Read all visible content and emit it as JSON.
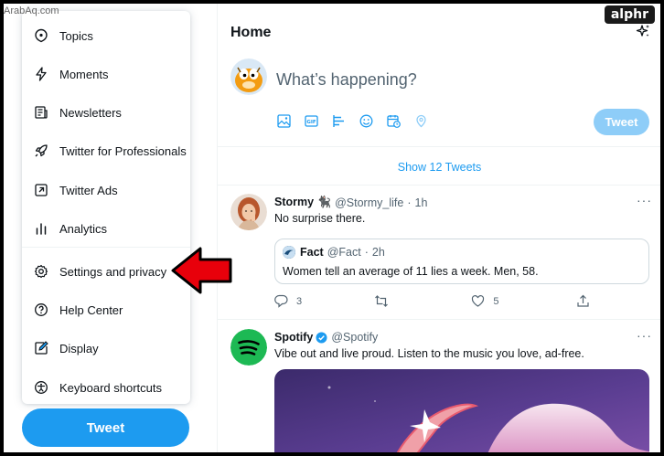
{
  "watermark": "ArabAq.com",
  "brand": "alphr",
  "menu": {
    "items": [
      {
        "label": "Topics",
        "icon": "topics-icon"
      },
      {
        "label": "Moments",
        "icon": "lightning-icon"
      },
      {
        "label": "Newsletters",
        "icon": "newsletter-icon"
      },
      {
        "label": "Twitter for Professionals",
        "icon": "rocket-icon"
      },
      {
        "label": "Twitter Ads",
        "icon": "external-arrow-icon"
      },
      {
        "label": "Analytics",
        "icon": "bar-chart-icon"
      },
      {
        "label": "Settings and privacy",
        "icon": "gear-icon"
      },
      {
        "label": "Help Center",
        "icon": "question-icon"
      },
      {
        "label": "Display",
        "icon": "pencil-icon"
      },
      {
        "label": "Keyboard shortcuts",
        "icon": "accessibility-icon"
      }
    ]
  },
  "sidebar": {
    "tweet_label": "Tweet"
  },
  "timeline": {
    "title": "Home",
    "compose": {
      "placeholder": "What’s happening?",
      "tweet_label": "Tweet"
    },
    "show_tweets": "Show 12 Tweets",
    "tweets": [
      {
        "name": "Stormy 🐈‍⬛",
        "handle": "@Stormy_life",
        "time": "1h",
        "text": "No surprise there.",
        "quote": {
          "name": "Fact",
          "handle": "@Fact",
          "time": "2h",
          "text": "Women tell an average of 11 lies a week. Men, 58."
        },
        "replies": "3",
        "likes": "5"
      },
      {
        "name": "Spotify",
        "handle": "@Spotify",
        "text": "Vibe out and live proud. Listen to the music you love, ad-free."
      }
    ]
  },
  "colors": {
    "accent": "#1d9bf0",
    "arrow": "#e8000b",
    "verified": "#1d9bf0",
    "spotify": "#1db954"
  }
}
